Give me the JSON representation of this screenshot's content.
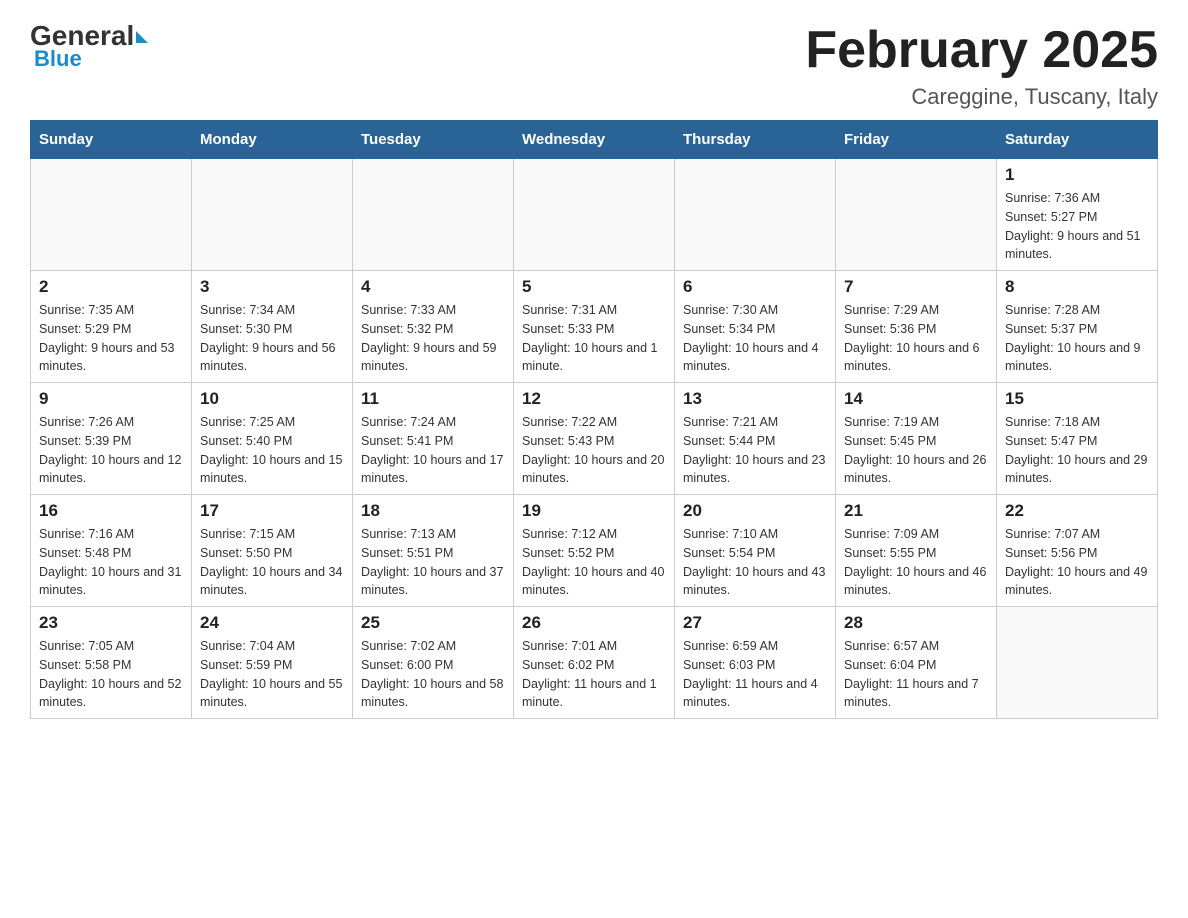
{
  "header": {
    "logo_general": "General",
    "logo_blue": "Blue",
    "title": "February 2025",
    "subtitle": "Careggine, Tuscany, Italy"
  },
  "weekdays": [
    "Sunday",
    "Monday",
    "Tuesday",
    "Wednesday",
    "Thursday",
    "Friday",
    "Saturday"
  ],
  "weeks": [
    [
      {
        "day": "",
        "info": ""
      },
      {
        "day": "",
        "info": ""
      },
      {
        "day": "",
        "info": ""
      },
      {
        "day": "",
        "info": ""
      },
      {
        "day": "",
        "info": ""
      },
      {
        "day": "",
        "info": ""
      },
      {
        "day": "1",
        "info": "Sunrise: 7:36 AM\nSunset: 5:27 PM\nDaylight: 9 hours and 51 minutes."
      }
    ],
    [
      {
        "day": "2",
        "info": "Sunrise: 7:35 AM\nSunset: 5:29 PM\nDaylight: 9 hours and 53 minutes."
      },
      {
        "day": "3",
        "info": "Sunrise: 7:34 AM\nSunset: 5:30 PM\nDaylight: 9 hours and 56 minutes."
      },
      {
        "day": "4",
        "info": "Sunrise: 7:33 AM\nSunset: 5:32 PM\nDaylight: 9 hours and 59 minutes."
      },
      {
        "day": "5",
        "info": "Sunrise: 7:31 AM\nSunset: 5:33 PM\nDaylight: 10 hours and 1 minute."
      },
      {
        "day": "6",
        "info": "Sunrise: 7:30 AM\nSunset: 5:34 PM\nDaylight: 10 hours and 4 minutes."
      },
      {
        "day": "7",
        "info": "Sunrise: 7:29 AM\nSunset: 5:36 PM\nDaylight: 10 hours and 6 minutes."
      },
      {
        "day": "8",
        "info": "Sunrise: 7:28 AM\nSunset: 5:37 PM\nDaylight: 10 hours and 9 minutes."
      }
    ],
    [
      {
        "day": "9",
        "info": "Sunrise: 7:26 AM\nSunset: 5:39 PM\nDaylight: 10 hours and 12 minutes."
      },
      {
        "day": "10",
        "info": "Sunrise: 7:25 AM\nSunset: 5:40 PM\nDaylight: 10 hours and 15 minutes."
      },
      {
        "day": "11",
        "info": "Sunrise: 7:24 AM\nSunset: 5:41 PM\nDaylight: 10 hours and 17 minutes."
      },
      {
        "day": "12",
        "info": "Sunrise: 7:22 AM\nSunset: 5:43 PM\nDaylight: 10 hours and 20 minutes."
      },
      {
        "day": "13",
        "info": "Sunrise: 7:21 AM\nSunset: 5:44 PM\nDaylight: 10 hours and 23 minutes."
      },
      {
        "day": "14",
        "info": "Sunrise: 7:19 AM\nSunset: 5:45 PM\nDaylight: 10 hours and 26 minutes."
      },
      {
        "day": "15",
        "info": "Sunrise: 7:18 AM\nSunset: 5:47 PM\nDaylight: 10 hours and 29 minutes."
      }
    ],
    [
      {
        "day": "16",
        "info": "Sunrise: 7:16 AM\nSunset: 5:48 PM\nDaylight: 10 hours and 31 minutes."
      },
      {
        "day": "17",
        "info": "Sunrise: 7:15 AM\nSunset: 5:50 PM\nDaylight: 10 hours and 34 minutes."
      },
      {
        "day": "18",
        "info": "Sunrise: 7:13 AM\nSunset: 5:51 PM\nDaylight: 10 hours and 37 minutes."
      },
      {
        "day": "19",
        "info": "Sunrise: 7:12 AM\nSunset: 5:52 PM\nDaylight: 10 hours and 40 minutes."
      },
      {
        "day": "20",
        "info": "Sunrise: 7:10 AM\nSunset: 5:54 PM\nDaylight: 10 hours and 43 minutes."
      },
      {
        "day": "21",
        "info": "Sunrise: 7:09 AM\nSunset: 5:55 PM\nDaylight: 10 hours and 46 minutes."
      },
      {
        "day": "22",
        "info": "Sunrise: 7:07 AM\nSunset: 5:56 PM\nDaylight: 10 hours and 49 minutes."
      }
    ],
    [
      {
        "day": "23",
        "info": "Sunrise: 7:05 AM\nSunset: 5:58 PM\nDaylight: 10 hours and 52 minutes."
      },
      {
        "day": "24",
        "info": "Sunrise: 7:04 AM\nSunset: 5:59 PM\nDaylight: 10 hours and 55 minutes."
      },
      {
        "day": "25",
        "info": "Sunrise: 7:02 AM\nSunset: 6:00 PM\nDaylight: 10 hours and 58 minutes."
      },
      {
        "day": "26",
        "info": "Sunrise: 7:01 AM\nSunset: 6:02 PM\nDaylight: 11 hours and 1 minute."
      },
      {
        "day": "27",
        "info": "Sunrise: 6:59 AM\nSunset: 6:03 PM\nDaylight: 11 hours and 4 minutes."
      },
      {
        "day": "28",
        "info": "Sunrise: 6:57 AM\nSunset: 6:04 PM\nDaylight: 11 hours and 7 minutes."
      },
      {
        "day": "",
        "info": ""
      }
    ]
  ]
}
